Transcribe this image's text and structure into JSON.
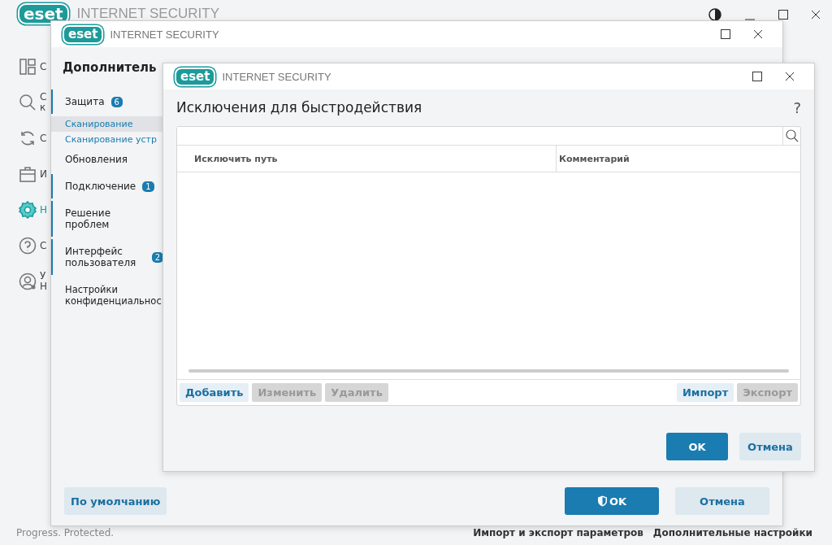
{
  "main_window": {
    "logo": "eset",
    "title": "INTERNET SECURITY",
    "nav": [
      {
        "label": [
          "С"
        ],
        "selected": false
      },
      {
        "label": [
          "С",
          "к"
        ],
        "selected": false
      },
      {
        "label": [
          "С"
        ],
        "selected": false
      },
      {
        "label": [
          "И"
        ],
        "selected": false
      },
      {
        "label": [
          "Н"
        ],
        "selected": true
      },
      {
        "label": [
          "С"
        ],
        "selected": false
      },
      {
        "label": [
          "У",
          "Н"
        ],
        "selected": false
      }
    ],
    "status": "Progress. Protected.",
    "footer_links": [
      "Импорт и экспорт параметров",
      "Дополнительные настройки"
    ]
  },
  "settings_window": {
    "logo": "eset",
    "title": "INTERNET SECURITY",
    "heading": "Дополнитель",
    "sections": [
      {
        "label": "Защита",
        "badge": "6",
        "marked": true,
        "selected": false,
        "children": [
          {
            "label": "Сканирование",
            "selected": true
          },
          {
            "label": "Сканирование устр",
            "selected": false
          }
        ]
      },
      {
        "label": "Обновления",
        "marked": false,
        "selected": false
      },
      {
        "label": "Подключение",
        "badge": "1",
        "marked": true,
        "selected": false
      },
      {
        "label": "Решение проблем",
        "marked": true,
        "selected": false
      },
      {
        "label": "Интерфейс пользователя",
        "badge": "2",
        "marked": true,
        "selected": false
      },
      {
        "label": "Настройки конфиденциальнос",
        "marked": false,
        "selected": false
      }
    ],
    "buttons": [
      {
        "label": "По умолчанию",
        "kind": "secondary"
      },
      {
        "label": "OK",
        "kind": "primary-shield"
      },
      {
        "label": "Отмена",
        "kind": "secondary"
      }
    ]
  },
  "dialog": {
    "logo": "eset",
    "title": "INTERNET SECURITY",
    "heading": "Исключения для быстродействия",
    "help": "?",
    "columns": [
      "Исключить путь",
      "Комментарий"
    ],
    "toolbar_left": [
      {
        "label": "Добавить",
        "disabled": false
      },
      {
        "label": "Изменить",
        "disabled": true
      },
      {
        "label": "Удалить",
        "disabled": true
      }
    ],
    "toolbar_right": [
      {
        "label": "Импорт",
        "disabled": false
      },
      {
        "label": "Экспорт",
        "disabled": true
      }
    ],
    "buttons": [
      {
        "label": "OK",
        "kind": "primary"
      },
      {
        "label": "Отмена",
        "kind": "secondary"
      }
    ]
  }
}
